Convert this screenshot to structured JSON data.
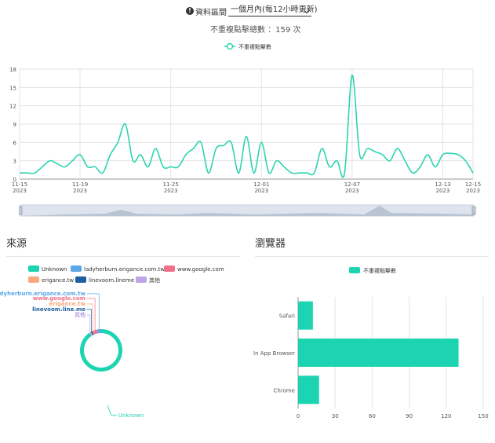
{
  "filter": {
    "label": "資料區間",
    "selected": "一個月內(每12小時更新)",
    "count_prefix": "不重複點擊總數",
    "count_value": "：159 次"
  },
  "colors": {
    "line": "#2dd4b0",
    "unknown": "#1dd4b2",
    "ladyherburn": "#5aa8e8",
    "google": "#f0718a",
    "erigance": "#f8a87a",
    "linevoom": "#1d5fa0",
    "other": "#c0a4e8"
  },
  "chart_data": [
    {
      "type": "line",
      "legend": [
        "不重複點擊數"
      ],
      "xlabels": [
        "11-15\n2023",
        "11-19\n2023",
        "11-25\n2023",
        "12-01\n2023",
        "12-07\n2023",
        "12-13\n2023",
        "12-15\n2023"
      ],
      "x_ticks_days": [
        0,
        4,
        10,
        16,
        22,
        28,
        30
      ],
      "ylim": [
        0,
        18
      ],
      "yticks": [
        0,
        3,
        6,
        9,
        12,
        15,
        18
      ],
      "series": [
        {
          "name": "不重複點擊數",
          "points": [
            [
              0,
              1
            ],
            [
              0.5,
              1
            ],
            [
              1,
              1
            ],
            [
              1.5,
              2
            ],
            [
              2,
              3
            ],
            [
              2.5,
              2.5
            ],
            [
              3,
              2
            ],
            [
              3.5,
              3
            ],
            [
              4,
              4
            ],
            [
              4.5,
              2
            ],
            [
              5,
              2
            ],
            [
              5.5,
              1
            ],
            [
              6,
              4
            ],
            [
              6.5,
              6
            ],
            [
              7,
              9
            ],
            [
              7.5,
              3
            ],
            [
              8,
              4
            ],
            [
              8.5,
              2
            ],
            [
              9,
              5
            ],
            [
              9.5,
              2
            ],
            [
              10,
              2
            ],
            [
              10.5,
              2
            ],
            [
              11,
              4
            ],
            [
              11.5,
              5
            ],
            [
              12,
              6
            ],
            [
              12.5,
              1
            ],
            [
              13,
              5
            ],
            [
              13.5,
              5.5
            ],
            [
              14,
              6
            ],
            [
              14.5,
              1
            ],
            [
              15,
              7
            ],
            [
              15.5,
              1
            ],
            [
              16,
              6
            ],
            [
              16.5,
              1
            ],
            [
              17,
              3
            ],
            [
              17.5,
              2
            ],
            [
              18,
              1
            ],
            [
              18.5,
              1
            ],
            [
              19,
              1
            ],
            [
              19.5,
              1
            ],
            [
              20,
              5
            ],
            [
              20.5,
              2
            ],
            [
              21,
              3
            ],
            [
              21.5,
              1
            ],
            [
              22,
              17
            ],
            [
              22.5,
              4
            ],
            [
              23,
              5
            ],
            [
              23.5,
              4.5
            ],
            [
              24,
              4
            ],
            [
              24.5,
              3
            ],
            [
              25,
              5
            ],
            [
              25.5,
              3
            ],
            [
              26,
              1
            ],
            [
              26.5,
              2
            ],
            [
              27,
              4
            ],
            [
              27.5,
              2
            ],
            [
              28,
              4
            ],
            [
              28.5,
              4.2
            ],
            [
              29,
              4
            ],
            [
              29.5,
              3
            ],
            [
              30,
              1
            ]
          ]
        }
      ]
    },
    {
      "type": "pie",
      "title": "來源",
      "legend": [
        "Unknown",
        "ladyherburn.erigance.com.tw",
        "www.google.com",
        "erigance.tw",
        "linevoom.lineme",
        "其他"
      ],
      "slices": [
        {
          "name": "Unknown",
          "value": 144
        },
        {
          "name": "ladyherburn.erigance.com.tw",
          "value": 5
        },
        {
          "name": "www.google.com",
          "value": 5
        },
        {
          "name": "erigance.tw",
          "value": 1
        },
        {
          "name": "linevoom.line.me",
          "value": 2
        },
        {
          "name": "其他",
          "value": 2
        }
      ],
      "slice_labels": [
        "Unknown",
        "ladyherburn.erigance.com.tw",
        "www.google.com",
        "erigance.tw",
        "linevoom.line.me",
        "其他"
      ]
    },
    {
      "type": "bar",
      "title": "瀏覽器",
      "orientation": "horizontal",
      "legend": [
        "不重複點擊數"
      ],
      "categories": [
        "Safari",
        "In App Browser",
        "Chrome"
      ],
      "values": [
        12,
        130,
        17
      ],
      "xlim": [
        0,
        150
      ],
      "xticks": [
        0,
        30,
        60,
        90,
        120,
        150
      ]
    }
  ]
}
